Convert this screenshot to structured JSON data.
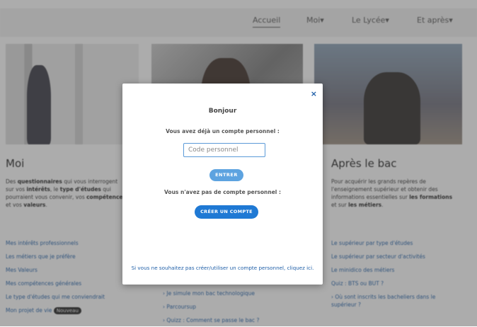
{
  "nav": {
    "items": [
      "Accueil",
      "Moi",
      "Le Lycée",
      "Et après"
    ]
  },
  "columns": {
    "left": {
      "title": "Moi",
      "text_parts": [
        "Des ",
        "questionnaires",
        " qui vous interrogent sur vos ",
        "intérêts",
        ", le ",
        "type d'études",
        " qui pourraient vous convenir, vos ",
        "compétences",
        " et vos ",
        "valeurs",
        "."
      ],
      "links": [
        "Mes intérêts professionnels",
        "Les métiers que je préfère",
        "Mes Valeurs",
        "Mes compétences générales",
        "Le type d'études qui me conviendrait",
        "Mon projet de vie"
      ],
      "new_badge": "Nouveau"
    },
    "middle": {
      "links": [
        "› Je simule mon bac technologique",
        "› Parcoursup",
        "› Quizz : Comment se passe le bac ?"
      ]
    },
    "right": {
      "title": "Après le bac",
      "text_parts": [
        "Pour acquérir les grands repères de l'enseignement supérieur et obtenir des informations essentielles sur ",
        "les formations",
        " et sur ",
        "les métiers",
        "."
      ],
      "links": [
        "Le supérieur par type d'études",
        "Le supérieur par secteur d'activités",
        "Le minidico des métiers",
        "Quiz : BTS ou BUT ?",
        "› Où sont inscrits les bacheliers dans le supérieur ?"
      ]
    }
  },
  "modal": {
    "close": "×",
    "title": "Bonjour",
    "question_account": "Vous avez déjà un compte personnel :",
    "code_placeholder": "Code personnel",
    "enter_button": "ENTRER",
    "question_no_account": "Vous n'avez pas de compte personnel :",
    "create_button": "CRÉER UN COMPTE",
    "skip_link": "Si vous ne souhaitez pas créer/utiliser un compte personnel, cliquez ici."
  },
  "colors": {
    "accent": "#1f79d4",
    "link": "#1f5fa8",
    "enter_button": "#5da3e0"
  }
}
